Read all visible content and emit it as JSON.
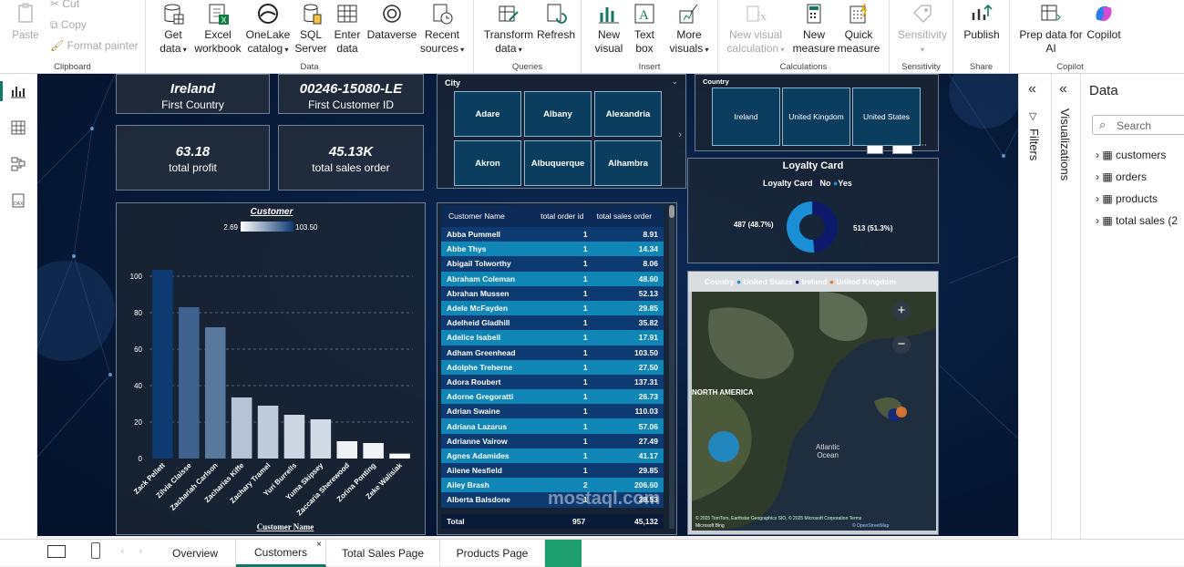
{
  "ribbon": {
    "clipboard": {
      "paste": "Paste",
      "cut": "Cut",
      "copy": "Copy",
      "format_painter": "Format painter",
      "group": "Clipboard"
    },
    "data": {
      "get_data": "Get",
      "get_data2": "data",
      "excel": "Excel",
      "excel2": "workbook",
      "onelake": "OneLake",
      "onelake2": "catalog",
      "sql": "SQL",
      "sql2": "Server",
      "enter": "Enter",
      "enter2": "data",
      "dataverse": "Dataverse",
      "recent": "Recent",
      "recent2": "sources",
      "group": "Data"
    },
    "queries": {
      "transform": "Transform",
      "transform2": "data",
      "refresh": "Refresh",
      "group": "Queries"
    },
    "insert": {
      "new_visual": "New",
      "new_visual2": "visual",
      "text_box": "Text",
      "text_box2": "box",
      "more": "More",
      "more2": "visuals",
      "group": "Insert"
    },
    "calculations": {
      "new_vis_calc": "New visual",
      "new_vis_calc2": "calculation",
      "new_measure": "New",
      "new_measure2": "measure",
      "quick_measure": "Quick",
      "quick_measure2": "measure",
      "group": "Calculations"
    },
    "sensitivity": {
      "label": "Sensitivity",
      "group": "Sensitivity"
    },
    "share": {
      "publish": "Publish",
      "group": "Share"
    },
    "copilot": {
      "prep": "Prep data for",
      "prep2": "AI",
      "copilot": "Copilot",
      "group": "Copilot"
    }
  },
  "kpis": {
    "first_country": "Ireland",
    "first_country_label": "First Country",
    "first_customer_id": "00246-15080-LE",
    "first_customer_id_label": "First Customer ID",
    "total_profit": "63.18",
    "total_profit_label": "total profit",
    "total_sales": "45.13K",
    "total_sales_label": "total sales order"
  },
  "city_slicer": {
    "title": "City",
    "items": [
      "Adare",
      "Albany",
      "Alexandria",
      "Akron",
      "Albuquerque",
      "Alhambra"
    ]
  },
  "country_slicer": {
    "title": "Country",
    "items": [
      "Ireland",
      "United Kingdom",
      "United States"
    ]
  },
  "loyalty": {
    "title": "Loyalty Card",
    "legend_title": "Loyalty Card",
    "no_label": "No",
    "yes_label": "Yes",
    "no_text": "487 (48.7%)",
    "yes_text": "513 (51.3%)",
    "no_value": 487,
    "yes_value": 513,
    "no_color": "#0d1a6b",
    "yes_color": "#1a8fd6"
  },
  "chart_data": {
    "type": "bar",
    "title": "Customer",
    "xlabel": "Customer Name",
    "ylabel": "",
    "legend_min": "2.69",
    "legend_max": "103.50",
    "categories": [
      "Zack Pellett",
      "Zilvia Claisse",
      "Zachariah Carlson",
      "Zacharias Kiffe",
      "Zachary Tramel",
      "Yuri Burrells",
      "Yuma Skipsey",
      "Zaccaria Sherewood",
      "Zorina Ponting",
      "Zeke Walisiak"
    ],
    "values": [
      103.5,
      83,
      72,
      33.5,
      29,
      24,
      21.5,
      9.5,
      8.5,
      2.69
    ],
    "ylim": [
      0,
      110
    ],
    "yticks": [
      "0",
      "20",
      "40",
      "60",
      "80",
      "100"
    ],
    "grid": true
  },
  "table": {
    "headers": [
      "Customer Name",
      "total order id",
      "total sales order"
    ],
    "rows": [
      [
        "Abba Pummell",
        "1",
        "8.91"
      ],
      [
        "Abbe Thys",
        "1",
        "14.34"
      ],
      [
        "Abigail Tolworthy",
        "1",
        "8.06"
      ],
      [
        "Abraham Coleman",
        "1",
        "48.60"
      ],
      [
        "Abrahan Mussen",
        "1",
        "52.13"
      ],
      [
        "Adele McFayden",
        "1",
        "29.85"
      ],
      [
        "Adelheid Gladhill",
        "1",
        "35.82"
      ],
      [
        "Adelice Isabell",
        "1",
        "17.91"
      ],
      [
        "Adham Greenhead",
        "1",
        "103.50"
      ],
      [
        "Adolphe Treherne",
        "1",
        "27.50"
      ],
      [
        "Adora Roubert",
        "1",
        "137.31"
      ],
      [
        "Adorne Gregoratti",
        "1",
        "26.73"
      ],
      [
        "Adrian Swaine",
        "1",
        "110.03"
      ],
      [
        "Adriana Lazarus",
        "1",
        "57.06"
      ],
      [
        "Adrianne Vairow",
        "1",
        "27.49"
      ],
      [
        "Agnes Adamides",
        "1",
        "41.17"
      ],
      [
        "Ailene Nesfield",
        "1",
        "29.85"
      ],
      [
        "Ailey Brash",
        "2",
        "206.60"
      ],
      [
        "Alberta Balsdone",
        "1",
        "28.53"
      ]
    ],
    "total_label": "Total",
    "total_orders": "957",
    "total_sales": "45,132"
  },
  "map": {
    "legend_title": "Country",
    "legend": [
      {
        "label": "United States",
        "color": "#1a8fd6"
      },
      {
        "label": "Ireland",
        "color": "#13237a"
      },
      {
        "label": "United Kingdom",
        "color": "#e6782d"
      }
    ],
    "label_na": "NORTH AMERICA",
    "label_ocean": "Atlantic",
    "label_ocean2": "Ocean",
    "attribution": "© 2025 TomTom, Earthstar Geographics SIO, © 2025 Microsoft Corporation",
    "terms": "Terms",
    "osm": "© OpenStreetMap",
    "bing": "Microsoft Bing"
  },
  "panes": {
    "filters": "Filters",
    "visualizations": "Visualizations",
    "data_title": "Data",
    "search_placeholder": "Search",
    "tables": [
      "customers",
      "orders",
      "products",
      "total sales (2"
    ]
  },
  "page_tabs": [
    "Overview",
    "Customers",
    "Total Sales Page",
    "Products Page"
  ],
  "watermark": "mostaql.com"
}
